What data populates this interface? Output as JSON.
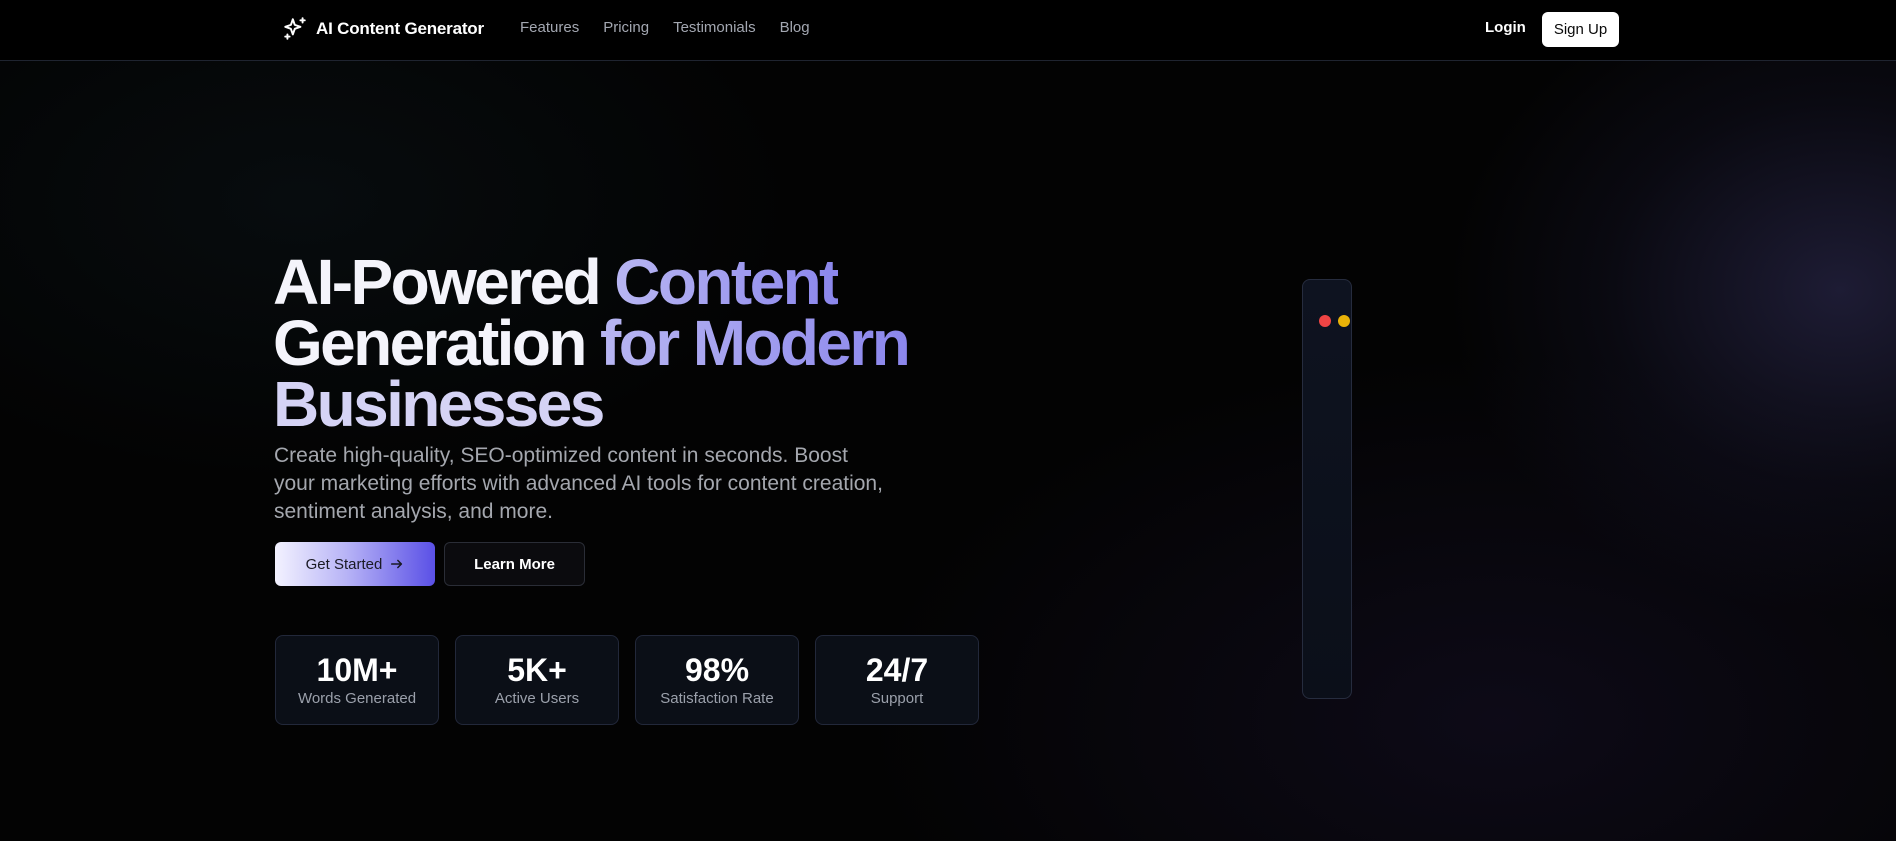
{
  "nav": {
    "brand": "AI Content Generator",
    "brand_icon": "sparkles-icon",
    "links": [
      "Features",
      "Pricing",
      "Testimonials",
      "Blog"
    ],
    "login": "Login",
    "signup": "Sign Up"
  },
  "hero": {
    "title_part1": "AI-Powered ",
    "title_part2": "Content",
    "title_part3": "Generation ",
    "title_part4": "for Modern",
    "title_part5": "Businesses",
    "subtitle": "Create high-quality, SEO-optimized content in seconds. Boost your marketing efforts with advanced AI tools for content creation, sentiment analysis, and more.",
    "primary_cta": "Get Started",
    "primary_cta_icon": "arrow-right-icon",
    "secondary_cta": "Learn More"
  },
  "stats": [
    {
      "value": "10M+",
      "label": "Words Generated"
    },
    {
      "value": "5K+",
      "label": "Active Users"
    },
    {
      "value": "98%",
      "label": "Satisfaction Rate"
    },
    {
      "value": "24/7",
      "label": "Support"
    }
  ],
  "colors": {
    "background": "#030303",
    "accent": "#8b86ec",
    "accent_light": "#b8b6f2",
    "window_dot_red": "#ef4444",
    "window_dot_yellow": "#eab308"
  }
}
